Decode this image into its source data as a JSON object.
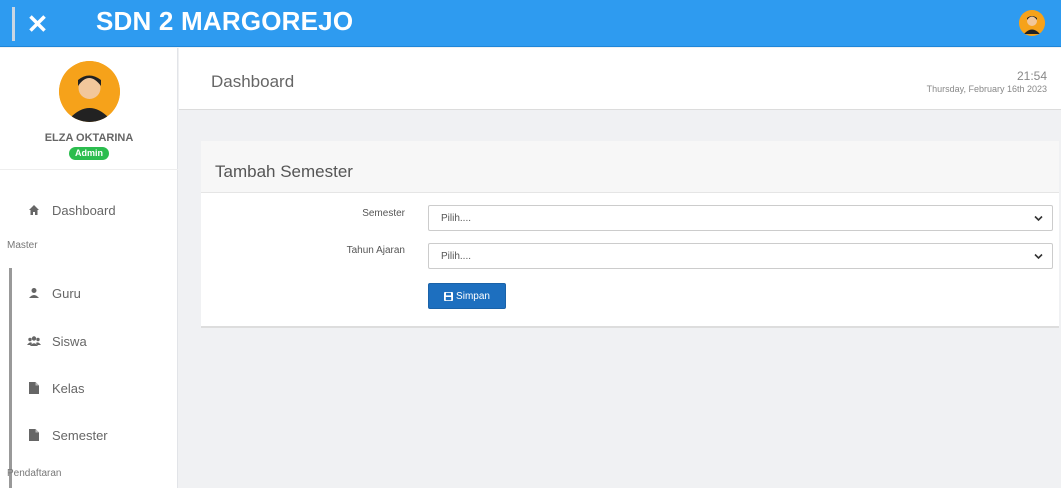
{
  "app": {
    "title": "SDN 2 MARGOREJO"
  },
  "user": {
    "name": "ELZA OKTARINA",
    "role": "Admin"
  },
  "sidebar": {
    "dashboard": "Dashboard",
    "section_master": "Master",
    "items": [
      {
        "label": "Guru",
        "icon": "user-icon"
      },
      {
        "label": "Siswa",
        "icon": "users-icon"
      },
      {
        "label": "Kelas",
        "icon": "file-icon"
      },
      {
        "label": "Semester",
        "icon": "file-icon"
      }
    ],
    "section_pendaftaran": "Pendaftaran"
  },
  "header": {
    "page_title": "Dashboard",
    "time": "21:54",
    "date": "Thursday, February 16th 2023"
  },
  "form": {
    "title": "Tambah Semester",
    "fields": [
      {
        "label": "Semester",
        "value": "Pilih...."
      },
      {
        "label": "Tahun Ajaran",
        "value": "Pilih...."
      }
    ],
    "submit_label": "Simpan"
  },
  "colors": {
    "topbar": "#2e9bf0",
    "primary_button": "#1d6fbf",
    "badge": "#2bbd4e",
    "avatar": "#f6a21a"
  }
}
